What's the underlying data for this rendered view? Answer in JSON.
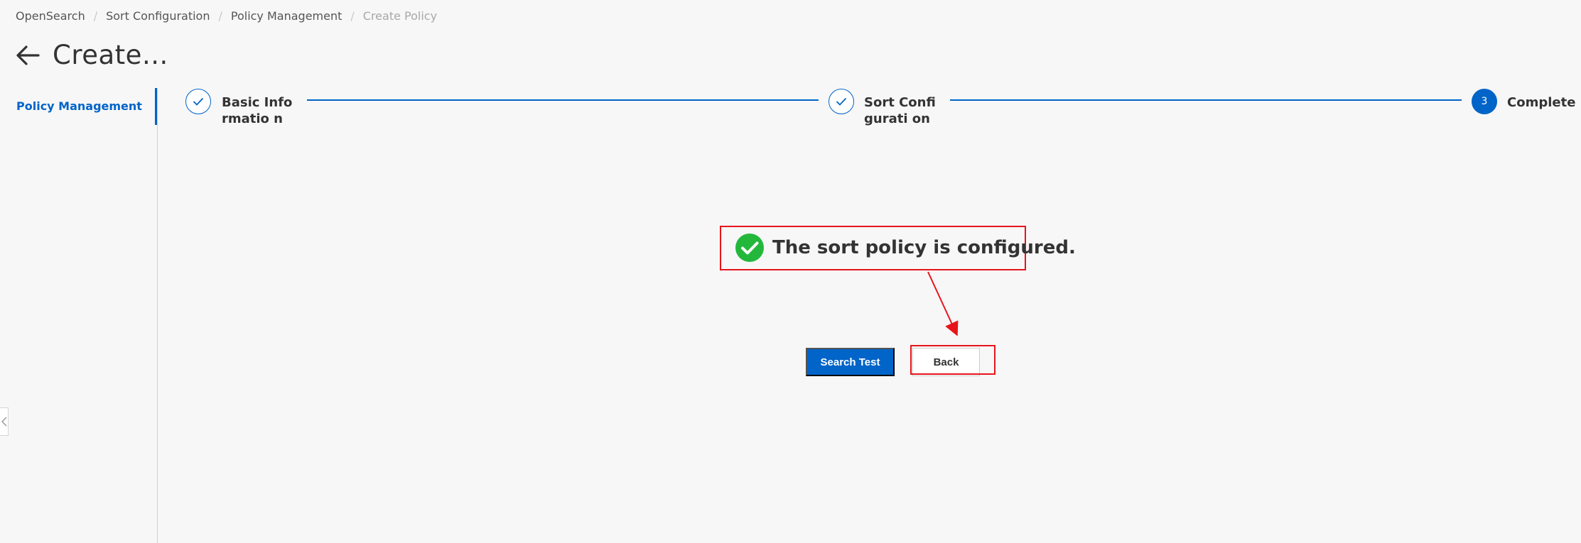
{
  "breadcrumb": {
    "items": [
      "OpenSearch",
      "Sort Configuration",
      "Policy Management"
    ],
    "current": "Create Policy",
    "separator": "/"
  },
  "header": {
    "title": "Create...",
    "back_icon": "arrow-left-icon"
  },
  "sidebar": {
    "items": [
      {
        "label": "Policy Management",
        "active": true
      }
    ]
  },
  "steps": [
    {
      "label": "Basic Informatio n",
      "status": "done",
      "icon": "check-icon"
    },
    {
      "label": "Sort Configurati on",
      "status": "done",
      "icon": "check-icon"
    },
    {
      "number": "3",
      "label": "Complete",
      "status": "active"
    }
  ],
  "result": {
    "icon": "success-check-icon",
    "message": "The sort policy is configured."
  },
  "actions": {
    "search_test_label": "Search Test",
    "back_label": "Back"
  },
  "colors": {
    "primary": "#0064c8",
    "success": "#23b83b",
    "annotation": "#e8141b"
  }
}
